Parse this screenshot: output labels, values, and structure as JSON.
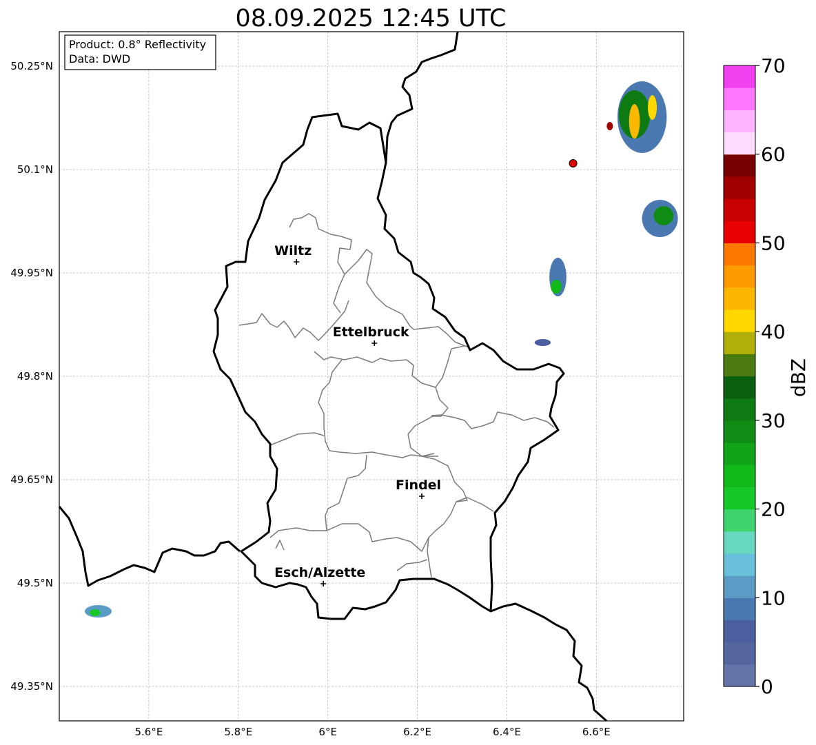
{
  "title": "08.09.2025 12:45 UTC",
  "info": {
    "product": "Product: 0.8° Reflectivity",
    "source": "Data: DWD"
  },
  "lat_ticks": [
    {
      "value": 50.25,
      "label": "50.25°N"
    },
    {
      "value": 50.1,
      "label": "50.1°N"
    },
    {
      "value": 49.95,
      "label": "49.95°N"
    },
    {
      "value": 49.8,
      "label": "49.8°N"
    },
    {
      "value": 49.65,
      "label": "49.65°N"
    },
    {
      "value": 49.5,
      "label": "49.5°N"
    },
    {
      "value": 49.35,
      "label": "49.35°N"
    }
  ],
  "lon_ticks": [
    {
      "value": 5.6,
      "label": "5.6°E"
    },
    {
      "value": 5.8,
      "label": "5.8°E"
    },
    {
      "value": 6.0,
      "label": "6°E"
    },
    {
      "value": 6.2,
      "label": "6.2°E"
    },
    {
      "value": 6.4,
      "label": "6.4°E"
    },
    {
      "value": 6.6,
      "label": "6.6°E"
    }
  ],
  "cities": [
    {
      "name": "Wiltz",
      "lon": 5.93,
      "lat": 49.966
    },
    {
      "name": "Ettelbruck",
      "lon": 6.104,
      "lat": 49.848
    },
    {
      "name": "Findel",
      "lon": 6.21,
      "lat": 49.626
    },
    {
      "name": "Esch/Alzette",
      "lon": 5.99,
      "lat": 49.499
    }
  ],
  "radar_site": {
    "lon": 6.548,
    "lat": 50.109,
    "color": "#e00000"
  },
  "colorbar": {
    "label": "dBZ",
    "ticks": [
      {
        "value": 0,
        "label": "0"
      },
      {
        "value": 10,
        "label": "10"
      },
      {
        "value": 20,
        "label": "20"
      },
      {
        "value": 30,
        "label": "30"
      },
      {
        "value": 40,
        "label": "40"
      },
      {
        "value": 50,
        "label": "50"
      },
      {
        "value": 60,
        "label": "60"
      },
      {
        "value": 70,
        "label": "70"
      }
    ],
    "step": 2.5,
    "colors": [
      "#6574a8",
      "#55669e",
      "#4a5ea0",
      "#4a78b0",
      "#5a9cc6",
      "#68c0da",
      "#68d8c0",
      "#40d470",
      "#14c828",
      "#10b818",
      "#12a418",
      "#0f8c14",
      "#0d7a12",
      "#0a6010",
      "#4a7a10",
      "#b0b008",
      "#ffd800",
      "#fcb800",
      "#fc9a00",
      "#fc7a00",
      "#e80000",
      "#c80000",
      "#a00000",
      "#780000",
      "#ffdcff",
      "#ffb4ff",
      "#ff78ff",
      "#f040f0"
    ]
  },
  "echoes": [
    {
      "lon": 6.702,
      "lat": 50.176,
      "rx": 0.055,
      "ry": 0.052,
      "dbz": 8,
      "cells": [
        {
          "lon": 6.685,
          "lat": 50.18,
          "rx": 0.035,
          "ry": 0.035,
          "dbz": 30
        },
        {
          "lon": 6.685,
          "lat": 50.17,
          "rx": 0.012,
          "ry": 0.025,
          "dbz": 44
        },
        {
          "lon": 6.725,
          "lat": 50.19,
          "rx": 0.01,
          "ry": 0.018,
          "dbz": 42
        },
        {
          "lon": 6.63,
          "lat": 50.163,
          "rx": 0.007,
          "ry": 0.006,
          "dbz": 55
        }
      ]
    },
    {
      "lon": 6.742,
      "lat": 50.029,
      "rx": 0.04,
      "ry": 0.027,
      "dbz": 9,
      "cells": [
        {
          "lon": 6.75,
          "lat": 50.033,
          "rx": 0.022,
          "ry": 0.014,
          "dbz": 28
        }
      ]
    },
    {
      "lon": 6.514,
      "lat": 49.944,
      "rx": 0.019,
      "ry": 0.028,
      "dbz": 9,
      "cells": [
        {
          "lon": 6.51,
          "lat": 49.93,
          "rx": 0.012,
          "ry": 0.01,
          "dbz": 24
        }
      ]
    },
    {
      "lon": 6.48,
      "lat": 49.849,
      "rx": 0.018,
      "ry": 0.005,
      "dbz": 7,
      "cells": []
    },
    {
      "lon": 5.487,
      "lat": 49.459,
      "rx": 0.03,
      "ry": 0.009,
      "dbz": 12,
      "cells": [
        {
          "lon": 5.48,
          "lat": 49.457,
          "rx": 0.012,
          "ry": 0.005,
          "dbz": 22
        }
      ]
    }
  ]
}
